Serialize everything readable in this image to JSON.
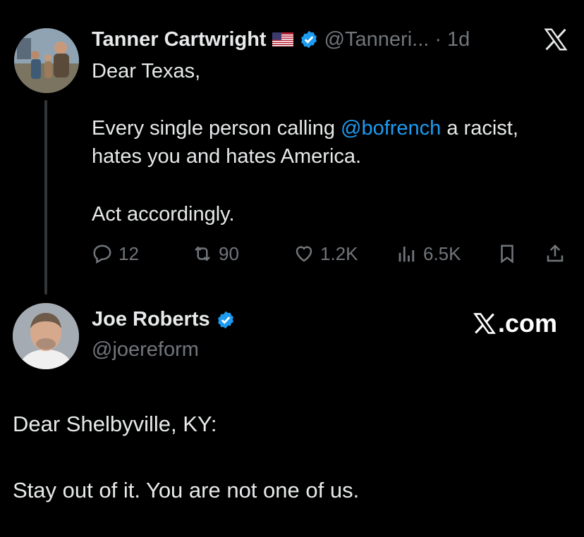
{
  "tweet": {
    "author_name": "Tanner Cartwright",
    "flag": "🇺🇸",
    "handle": "@Tanneri...",
    "time": "· 1d",
    "lines": [
      "Dear Texas,"
    ],
    "line2_pre": "Every single person calling ",
    "mention": "@bofrench",
    "line2_post": " a racist,",
    "line3": "hates you and hates America.",
    "line4": "Act accordingly.",
    "stats": {
      "replies": "12",
      "reposts": "90",
      "likes": "1.2K",
      "views": "6.5K"
    },
    "icons": {
      "reply": "reply-icon",
      "repost": "repost-icon",
      "like": "heart-icon",
      "views": "views-icon",
      "bookmark": "bookmark-icon",
      "share": "share-icon"
    }
  },
  "card": {
    "author_name": "Joe Roberts",
    "handle": "@joereform",
    "brand": ".com",
    "line1": "Dear Shelbyville, KY:",
    "line2": "Stay out of it. You are not one of us."
  },
  "colors": {
    "background": "#000000",
    "text": "#e7e9ea",
    "muted": "#71767b",
    "link": "#1d9bf0",
    "verified": "#1d9bf0"
  }
}
